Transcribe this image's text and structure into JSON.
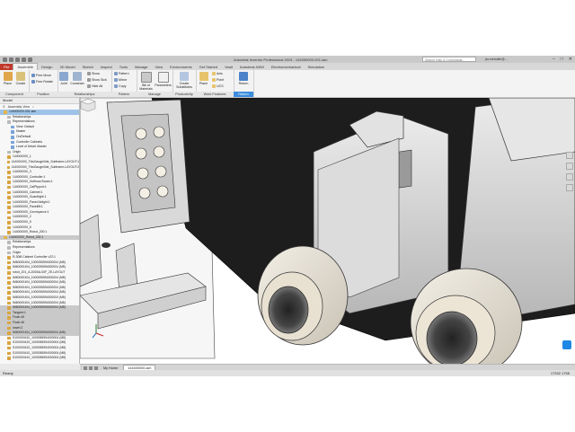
{
  "window": {
    "title": "Autodesk Inventor Professional 2019 - 144000000-001.iam",
    "search_placeholder": "Search Help & Commands...",
    "user": "jsv.metcalfe@...",
    "controls": [
      "–",
      "□",
      "✕"
    ]
  },
  "tabs": [
    "File",
    "Assemble",
    "Design",
    "3D Model",
    "Sketch",
    "Inspect",
    "Tools",
    "Manage",
    "View",
    "Environments",
    "Get Started",
    "Vault",
    "Autodesk A360",
    "Electromechanical",
    "Simulation"
  ],
  "active_tab": "Assemble",
  "ribbon": {
    "groups": [
      {
        "label": "Component",
        "buttons": [
          "Place",
          "Create"
        ]
      },
      {
        "label": "Position",
        "buttons": [
          "Free Move",
          "Free Rotate"
        ]
      },
      {
        "label": "Relationships",
        "buttons": [
          "Joint",
          "Constrain",
          "Show",
          "Show Sick",
          "Hide All"
        ]
      },
      {
        "label": "Pattern",
        "buttons": [
          "Pattern",
          "Mirror",
          "Copy"
        ]
      },
      {
        "label": "Manage",
        "buttons": [
          "Bill of Materials",
          "Parameters"
        ]
      },
      {
        "label": "Productivity",
        "buttons": [
          "Create Substitutes"
        ]
      },
      {
        "label": "Work Features",
        "buttons": [
          "Plane",
          "Axis",
          "Point",
          "UCS"
        ]
      },
      {
        "label": "Return",
        "buttons": [
          "Return"
        ]
      }
    ]
  },
  "browser": {
    "title": "Model",
    "view_label": "Assembly View",
    "items": [
      {
        "label": "144000000-001.iam",
        "type": "asm",
        "sel": true
      },
      {
        "label": "Relationships",
        "type": "folder"
      },
      {
        "label": "Representations",
        "type": "folder"
      },
      {
        "label": "View: Default",
        "type": "rep"
      },
      {
        "label": "Master",
        "type": "rep"
      },
      {
        "label": "On/Default",
        "type": "rep"
      },
      {
        "label": "Controller Cabinets",
        "type": "rep"
      },
      {
        "label": "Level of Detail: Master",
        "type": "rep"
      },
      {
        "label": "Origin",
        "type": "folder"
      },
      {
        "label": "144000000_1",
        "type": "part"
      },
      {
        "label": "144000000_ThisGauge0ide_Subframe-LAYOUT:1",
        "type": "part"
      },
      {
        "label": "144000000_ThisGauge0ide_Subframe-LAYOUT:2",
        "type": "part"
      },
      {
        "label": "144000000_3",
        "type": "part"
      },
      {
        "label": "144000000_Controller:1",
        "type": "part"
      },
      {
        "label": "144000000_Hoffman Boxes:1",
        "type": "part"
      },
      {
        "label": "144000000_CatPlpport:1",
        "type": "part"
      },
      {
        "label": "144000000_Cabinet:1",
        "type": "part"
      },
      {
        "label": "144000000_Guardlight:1",
        "type": "part"
      },
      {
        "label": "144000000_Panel:Airlight:1",
        "type": "part"
      },
      {
        "label": "144000000_Panellift:1",
        "type": "part"
      },
      {
        "label": "144000000_Conveyance:1",
        "type": "part"
      },
      {
        "label": "144000000_2",
        "type": "part"
      },
      {
        "label": "144000000_5",
        "type": "part"
      },
      {
        "label": "144000000_6",
        "type": "part"
      },
      {
        "label": "144000000_Robot_200:1",
        "type": "part"
      },
      {
        "label": "144000000_Robot_200:1",
        "type": "asm",
        "grey": true
      },
      {
        "label": "Relationships",
        "type": "folder"
      },
      {
        "label": "Representations",
        "type": "folder"
      },
      {
        "label": "Origin",
        "type": "folder"
      },
      {
        "label": "R-30iB Cabinet Controller v22:1",
        "type": "part"
      },
      {
        "label": "IM60000404_1000055594000004 (M8)",
        "type": "part"
      },
      {
        "label": "IM60000404_1000055594000004 (M8)",
        "type": "part"
      },
      {
        "label": "robot_201_A-2000iA-00F_2E-LAYOUT",
        "type": "part"
      },
      {
        "label": "IM60000404_1000055594000004 (M8)",
        "type": "part"
      },
      {
        "label": "IM60000404_1000055594000004 (M8)",
        "type": "part"
      },
      {
        "label": "IM60000404_1000055594000004 (M8)",
        "type": "part"
      },
      {
        "label": "IM60000404_1000055594000004 (M8)",
        "type": "part"
      },
      {
        "label": "IM60000404_1000055594000004 (M8)",
        "type": "part"
      },
      {
        "label": "IM60000404_1000055594000004 (M8)",
        "type": "part"
      },
      {
        "label": "IM60000404_1000055594000004 (M8)",
        "type": "part",
        "grey": true
      },
      {
        "label": "Tangent:1",
        "type": "part",
        "grey": true
      },
      {
        "label": "Flush:45",
        "type": "part",
        "grey": true
      },
      {
        "label": "Flush:46",
        "type": "part",
        "grey": true
      },
      {
        "label": "Insert:2",
        "type": "part",
        "grey": true
      },
      {
        "label": "IM60000404_1000055594000004 (M8)",
        "type": "part",
        "grey": true
      },
      {
        "label": "S100000410_1000055594000004 (M8)",
        "type": "part"
      },
      {
        "label": "S100000410_1000055594000004 (M8)",
        "type": "part"
      },
      {
        "label": "S100000410_1000055594000004 (M8)",
        "type": "part"
      },
      {
        "label": "S100000410_1000055594000004 (M8)",
        "type": "part"
      },
      {
        "label": "S100000410_1000055594000004 (M8)",
        "type": "part"
      },
      {
        "label": "S100000410_1000055594000004 (M8)",
        "type": "part"
      },
      {
        "label": "S100000410_1000055594000004 (M8)",
        "type": "part"
      }
    ]
  },
  "doc_tabs": [
    "My Home",
    "144000000.iam"
  ],
  "active_doc": "144000000.iam",
  "status": {
    "left": "Ready",
    "right": "17332   1755"
  },
  "colors": {
    "accent": "#3c8dde",
    "file_tab": "#c0392b",
    "selection": "#9fc3e8"
  }
}
